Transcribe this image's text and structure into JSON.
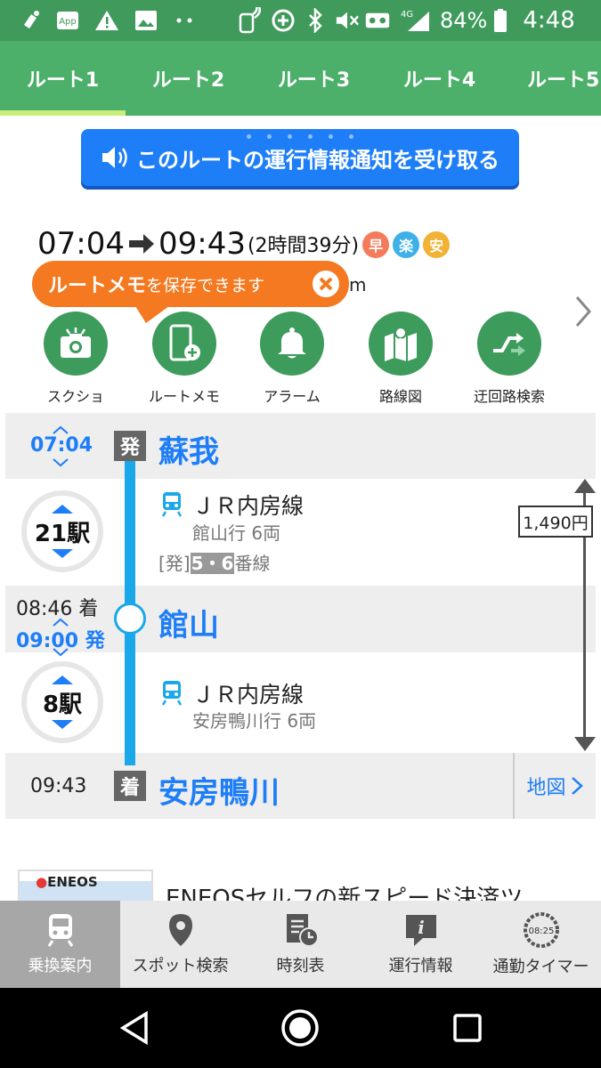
{
  "status_bar": {
    "battery": "84%",
    "time": "4:48",
    "network": "4G",
    "icons": [
      "app-download-icon",
      "app-icon",
      "warning-icon",
      "image-icon",
      "more-dots-icon",
      "nfc-icon",
      "data-saver-icon",
      "bluetooth-icon",
      "mute-icon",
      "voicemail-icon",
      "signal-icon",
      "battery-icon"
    ]
  },
  "tabs": [
    {
      "label": "ルート1"
    },
    {
      "label": "ルート2"
    },
    {
      "label": "ルート3"
    },
    {
      "label": "ルート4"
    },
    {
      "label": "ルート5"
    }
  ],
  "notify_button": {
    "label": "このルートの運行情報通知を受け取る"
  },
  "summary": {
    "depart": "07:04",
    "arrive": "09:43",
    "duration": "(2時間39分)",
    "badges": [
      {
        "label": "早",
        "color": "#f47c5c"
      },
      {
        "label": "楽",
        "color": "#3fb0e8"
      },
      {
        "label": "安",
        "color": "#f2b233"
      }
    ],
    "trailing_text": "m"
  },
  "tooltip": {
    "strong": "ルートメモ",
    "rest": "を保存できます"
  },
  "actions": [
    {
      "label": "スクショ",
      "icon": "camera-icon"
    },
    {
      "label": "ルートメモ",
      "icon": "phone-add-icon"
    },
    {
      "label": "アラーム",
      "icon": "bell-icon"
    },
    {
      "label": "路線図",
      "icon": "map-pin-icon"
    },
    {
      "label": "迂回路検索",
      "icon": "detour-icon"
    }
  ],
  "route": {
    "origin": {
      "time": "07:04",
      "marker": "発",
      "name": "蘇我"
    },
    "legs": [
      {
        "stops": "21駅",
        "line": "ＪＲ内房線",
        "dest": "館山行 6両",
        "platform_prefix": "[発]",
        "platform_num": "5・6",
        "platform_suffix": "番線"
      },
      {
        "stops": "8駅",
        "line": "ＪＲ内房線",
        "dest": "安房鴨川行 6両"
      }
    ],
    "transfer": {
      "arr_time": "08:46 着",
      "dep_time": "09:00 発",
      "name": "館山"
    },
    "destination": {
      "time": "09:43",
      "marker": "着",
      "name": "安房鴨川"
    },
    "fare": "1,490円",
    "map_link": "地図"
  },
  "ad": {
    "logo": "ENEOS",
    "text": "ENEOSセルフの新スピード決済ツ"
  },
  "bottom_nav": [
    {
      "label": "乗換案内",
      "icon": "train-icon",
      "active": true
    },
    {
      "label": "スポット検索",
      "icon": "location-pin-icon",
      "active": false
    },
    {
      "label": "時刻表",
      "icon": "timetable-icon",
      "active": false
    },
    {
      "label": "運行情報",
      "icon": "info-bubble-icon",
      "active": false
    },
    {
      "label": "通勤タイマー",
      "icon": "timer-icon",
      "timer_value": "08:25",
      "active": false
    }
  ],
  "colors": {
    "status_bar": "#3f9a5c",
    "tab_bar": "#4caf6a",
    "tab_indicator": "#c9ef7a",
    "accent_blue": "#1e7ef7",
    "route_line": "#1aa8ea",
    "tooltip_orange": "#f47920"
  }
}
